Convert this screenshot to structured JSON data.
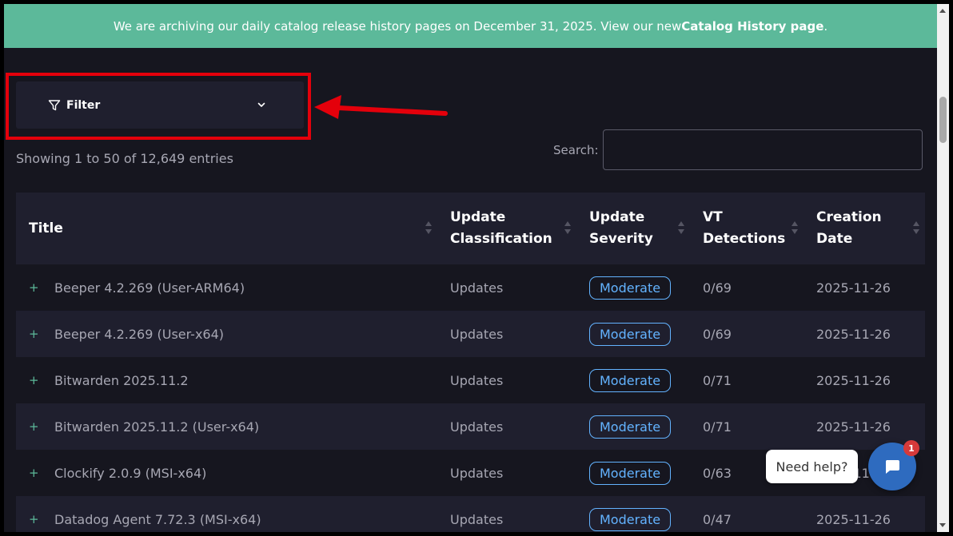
{
  "banner": {
    "text_before": "We are archiving our daily catalog release history pages on December 31, 2025. View our new ",
    "link": "Catalog History page",
    "text_after": "."
  },
  "filter": {
    "label": "Filter"
  },
  "showing": "Showing 1 to 50 of 12,649 entries",
  "search": {
    "label": "Search:",
    "value": "",
    "placeholder": ""
  },
  "table": {
    "headers": {
      "title": "Title",
      "classification_1": "Update",
      "classification_2": "Classification",
      "severity_1": "Update",
      "severity_2": "Severity",
      "vt_1": "VT",
      "vt_2": "Detections",
      "date_1": "Creation",
      "date_2": "Date"
    },
    "rows": [
      {
        "expand": "+",
        "title": "Beeper 4.2.269 (User-ARM64)",
        "classification": "Updates",
        "severity": "Moderate",
        "vt": "0/69",
        "date": "2025-11-26"
      },
      {
        "expand": "+",
        "title": "Beeper 4.2.269 (User-x64)",
        "classification": "Updates",
        "severity": "Moderate",
        "vt": "0/69",
        "date": "2025-11-26"
      },
      {
        "expand": "+",
        "title": "Bitwarden 2025.11.2",
        "classification": "Updates",
        "severity": "Moderate",
        "vt": "0/71",
        "date": "2025-11-26"
      },
      {
        "expand": "+",
        "title": "Bitwarden 2025.11.2 (User-x64)",
        "classification": "Updates",
        "severity": "Moderate",
        "vt": "0/71",
        "date": "2025-11-26"
      },
      {
        "expand": "+",
        "title": "Clockify 2.0.9 (MSI-x64)",
        "classification": "Updates",
        "severity": "Moderate",
        "vt": "0/63",
        "date": "2025-11-26"
      },
      {
        "expand": "+",
        "title": "Datadog Agent 7.72.3 (MSI-x64)",
        "classification": "Updates",
        "severity": "Moderate",
        "vt": "0/47",
        "date": "2025-11-26"
      }
    ]
  },
  "chat": {
    "help_text": "Need help?",
    "badge_count": "1"
  },
  "colors": {
    "banner": "#5cb99a",
    "background": "#16161f",
    "row_alt": "#1f1f2e",
    "badge": "#63b3ff",
    "annotation": "#e4000b",
    "chat": "#2e6bbf"
  }
}
